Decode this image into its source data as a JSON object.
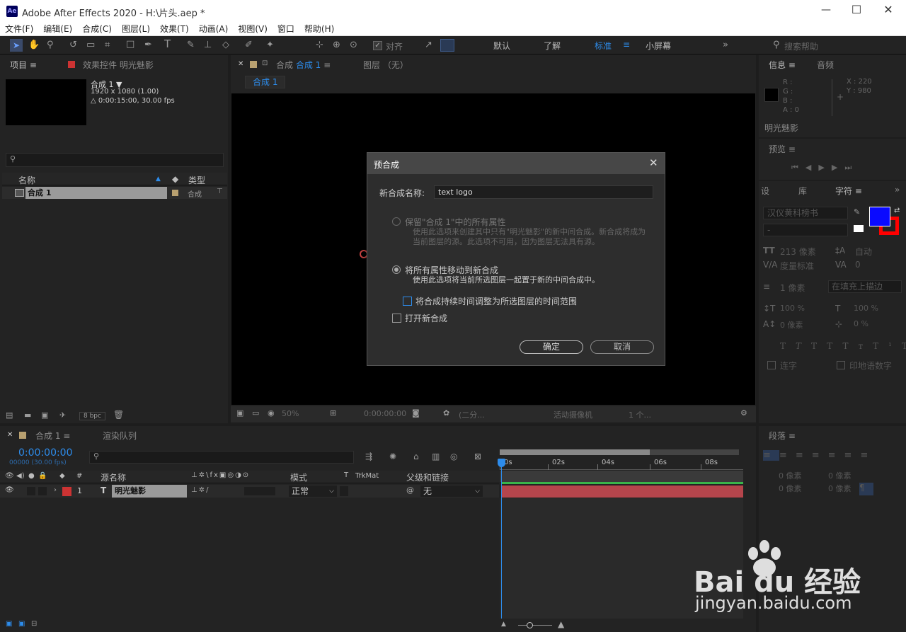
{
  "window": {
    "app_badge": "Ae",
    "title": "Adobe After Effects 2020 - H:\\片头.aep *"
  },
  "menu": [
    "文件(F)",
    "编辑(E)",
    "合成(C)",
    "图层(L)",
    "效果(T)",
    "动画(A)",
    "视图(V)",
    "窗口",
    "帮助(H)"
  ],
  "toolbar": {
    "snap_label": "对齐",
    "workspaces": [
      "默认",
      "了解",
      "标准",
      "小屏幕"
    ],
    "active_workspace": "标准",
    "search_placeholder": "搜索帮助"
  },
  "project": {
    "tab": "项目",
    "effects_tab": "效果控件 明光魅影",
    "comp_name": "合成 1 ▼",
    "comp_dims": "1920 x 1080 (1.00)",
    "comp_duration": "△ 0:00:15:00, 30.00 fps",
    "col_name": "名称",
    "col_type": "类型",
    "item_name": "合成 1",
    "item_type": "合成",
    "bpc": "8 bpc"
  },
  "viewer": {
    "tab_label": "合成",
    "tab_name": "合成 1",
    "layer_tab": "图层 （无）",
    "breadcrumb": "合成 1",
    "zoom": "50%",
    "timecode": "0:00:00:00",
    "resolution": "(二分...",
    "camera": "活动摄像机",
    "views": "1 个..."
  },
  "info": {
    "tab": "信息",
    "audio_tab": "音频",
    "r": "R :",
    "g": "G :",
    "b": "B :",
    "a": "A : 0",
    "x": "X : 220",
    "y": "Y : 980",
    "layer_name": "明光魅影"
  },
  "preview": {
    "tab": "预览"
  },
  "character": {
    "tab_a": "设",
    "tab_b": "库",
    "tab": "字符",
    "font": "汉仪黄科榜书",
    "style": "-",
    "size": "213 像素",
    "leading": "自动",
    "kerning": "度量标准",
    "tracking": "0",
    "stroke_width": "1 像素",
    "stroke_mode": "在填充上描边",
    "vscale": "100 %",
    "hscale": "100 %",
    "baseline": "0 像素",
    "tsume": "0 %",
    "ligatures": "连字",
    "hindi": "印地语数字",
    "fill_color": "#0a0aff",
    "stroke_color": "#ff0000"
  },
  "paragraph": {
    "tab": "段落",
    "indent": "0 像素"
  },
  "timeline": {
    "tab": "合成 1",
    "render_tab": "渲染队列",
    "timecode": "0:00:00:00",
    "frames": "00000 (30.00 fps)",
    "col_source": "源名称",
    "col_mode": "模式",
    "col_t": "T",
    "col_trkmat": "TrkMat",
    "col_parent": "父级和链接",
    "layer_num": "1",
    "layer_type": "T",
    "layer_name": "明光魅影",
    "layer_mode": "正常",
    "layer_parent": "无",
    "ticks": [
      "0s",
      "02s",
      "04s",
      "06s",
      "08s"
    ]
  },
  "dialog": {
    "title": "预合成",
    "name_label": "新合成名称:",
    "name_value": "text logo",
    "opt1_title": "保留\"合成 1\"中的所有属性",
    "opt1_desc": "使用此选项来创建其中只有\"明光魅影\"的新中间合成。新合成将成为当前图层的源。此选项不可用，因为图层无法具有源。",
    "opt2_title": "将所有属性移动到新合成",
    "opt2_desc": "使用此选项将当前所选图层一起置于新的中间合成中。",
    "check_adjust": "将合成持续时间调整为所选图层的时间范围",
    "check_open": "打开新合成",
    "ok": "确定",
    "cancel": "取消"
  },
  "watermark": {
    "brand": "Bai du 经验",
    "url": "jingyan.baidu.com"
  }
}
